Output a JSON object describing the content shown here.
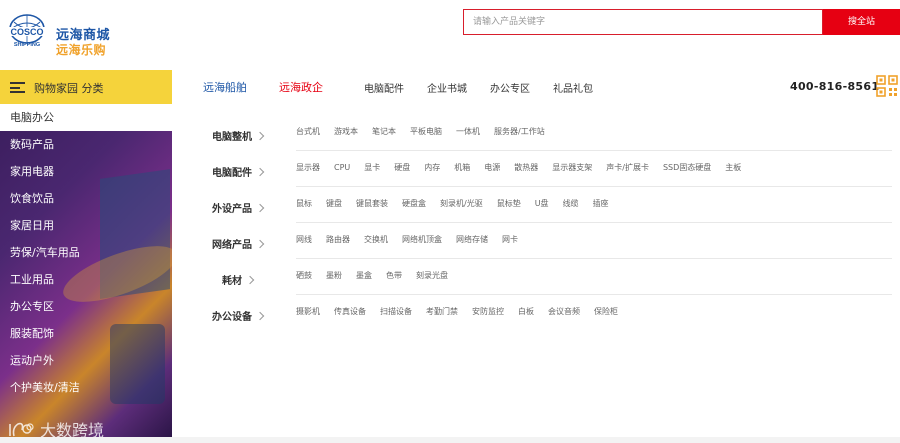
{
  "brand": {
    "logo_mark_text": "COSCO",
    "logo_mark_subtext": "SHIPPING",
    "name_line1": "远海商城",
    "name_line2": "远海乐购",
    "colors": {
      "blue": "#1d56a6",
      "orange": "#f0a22b",
      "red": "#e60012",
      "yellow": "#f5d33b"
    }
  },
  "search": {
    "placeholder": "请输入产品关键字",
    "button_label": "搜全站"
  },
  "nav": {
    "category_toggle_label": "购物家园 分类",
    "links": [
      "远海船舶",
      "远海政企",
      "电脑配件",
      "企业书城",
      "办公专区",
      "礼品礼包"
    ],
    "hotline": "400-816-8561",
    "qr_icon": "qr-code-icon"
  },
  "sidebar": {
    "items": [
      "电脑办公",
      "数码产品",
      "家用电器",
      "饮食饮品",
      "家居日用",
      "劳保/汽车用品",
      "工业用品",
      "办公专区",
      "服装配饰",
      "运动户外",
      "个护美妆/清洁"
    ],
    "active_index": 0,
    "watermark": "大数跨境"
  },
  "panel": {
    "rows": [
      {
        "title": "电脑整机",
        "links": [
          "台式机",
          "游戏本",
          "笔记本",
          "平板电脑",
          "一体机",
          "服务器/工作站"
        ]
      },
      {
        "title": "电脑配件",
        "links": [
          "显示器",
          "CPU",
          "显卡",
          "硬盘",
          "内存",
          "机箱",
          "电源",
          "散热器",
          "显示器支架",
          "声卡/扩展卡",
          "SSD固态硬盘",
          "主板"
        ]
      },
      {
        "title": "外设产品",
        "links": [
          "鼠标",
          "键盘",
          "键鼠套装",
          "硬盘盒",
          "刻录机/光驱",
          "鼠标垫",
          "U盘",
          "线缆",
          "插座"
        ]
      },
      {
        "title": "网络产品",
        "links": [
          "网线",
          "路由器",
          "交换机",
          "网络机顶盒",
          "网络存储",
          "网卡"
        ]
      },
      {
        "title": "耗材",
        "links": [
          "硒鼓",
          "墨粉",
          "墨盒",
          "色带",
          "刻录光盘"
        ]
      },
      {
        "title": "办公设备",
        "links": [
          "摄影机",
          "传真设备",
          "扫描设备",
          "考勤门禁",
          "安防监控",
          "白板",
          "会议音频",
          "保险柜"
        ]
      }
    ]
  }
}
